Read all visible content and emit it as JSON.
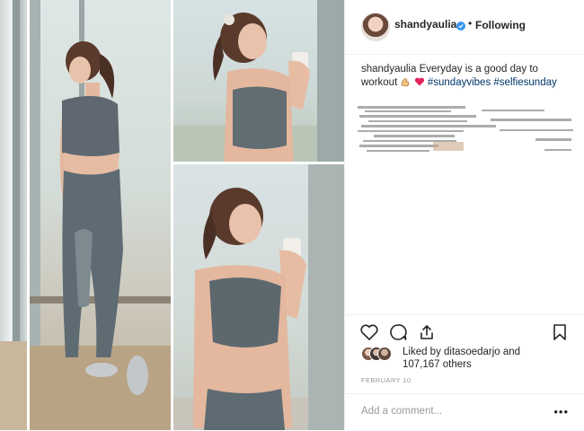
{
  "post": {
    "username": "shandyaulia",
    "separator": "•",
    "follow_status": "Following",
    "caption": {
      "username": "shandyaulia",
      "text": " Everyday is a good day to workout ",
      "hashtags": [
        "#sundayvibes",
        "#selfiesunday"
      ]
    },
    "likes": {
      "liked_by_prefix": "Liked by ",
      "liked_by_user": "ditasoedarjo",
      "and": " and",
      "count_text": "107,167 others"
    },
    "date": "FEBRUARY 10",
    "comment_placeholder": "Add a comment...",
    "more_label": "•••"
  },
  "icons": [
    "avatar",
    "verified-badge-icon",
    "heart-icon",
    "comment-icon",
    "share-icon",
    "bookmark-icon",
    "flexed-bicep-emoji-icon",
    "red-heart-emoji-icon"
  ],
  "colors": {
    "text": "#262626",
    "hashtag": "#003569",
    "muted": "#999999",
    "verified": "#3897f0",
    "divider": "#efefef"
  }
}
